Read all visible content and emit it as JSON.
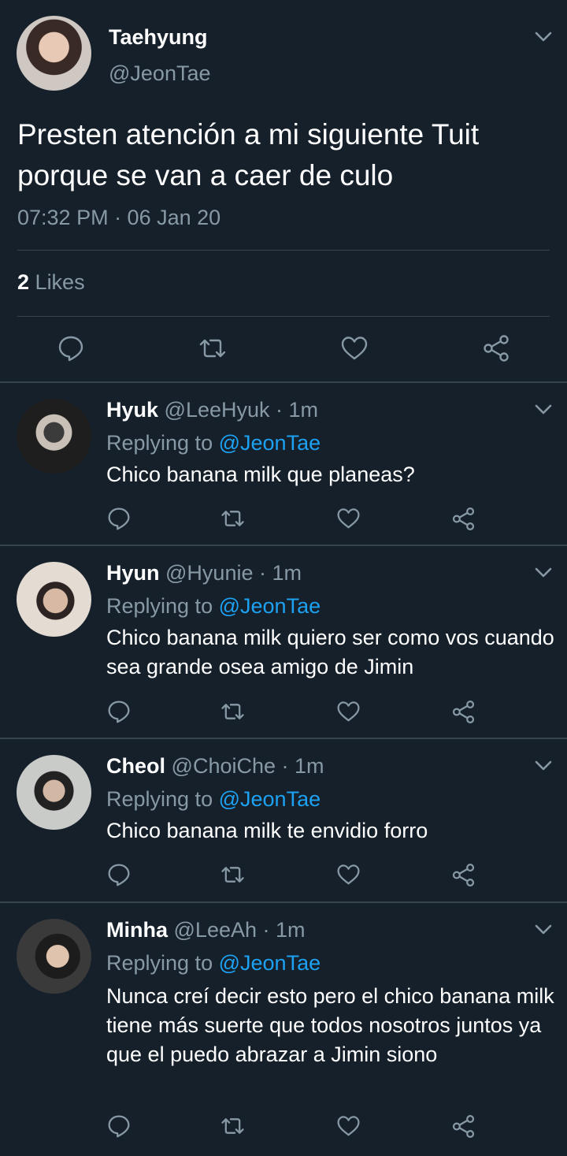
{
  "main_tweet": {
    "name": "Taehyung",
    "handle": "@JeonTae",
    "text": "Presten atención a mi siguiente Tuit porque se van a caer de culo",
    "timestamp": "07:32 PM · 06 Jan 20",
    "likes_count": "2",
    "likes_label": "Likes"
  },
  "replies": [
    {
      "name": "Hyuk",
      "handle": "@LeeHyuk",
      "time": "· 1m",
      "replying_prefix": "Replying to",
      "replying_to": "@JeonTae",
      "text": "Chico banana milk que planeas?"
    },
    {
      "name": "Hyun",
      "handle": "@Hyunie",
      "time": "· 1m",
      "replying_prefix": "Replying to",
      "replying_to": "@JeonTae",
      "text": "Chico banana milk quiero ser como vos cuando sea grande osea amigo de Jimin"
    },
    {
      "name": "Cheol",
      "handle": "@ChoiChe",
      "time": "· 1m",
      "replying_prefix": "Replying to",
      "replying_to": "@JeonTae",
      "text": "Chico banana milk te envidio forro"
    },
    {
      "name": "Minha",
      "handle": "@LeeAh",
      "time": "· 1m",
      "replying_prefix": "Replying to",
      "replying_to": "@JeonTae",
      "text": "Nunca creí decir esto pero el chico banana milk tiene más suerte que todos nosotros juntos ya que el puedo abrazar a Jimin siono"
    }
  ],
  "icons": {
    "reply": "comment-icon",
    "retweet": "retweet-icon",
    "like": "heart-icon",
    "share": "share-icon",
    "menu": "chevron-down-icon"
  },
  "colors": {
    "background": "#15202b",
    "secondary_text": "#8899a6",
    "accent": "#1da1f2",
    "divider": "#38444d"
  }
}
